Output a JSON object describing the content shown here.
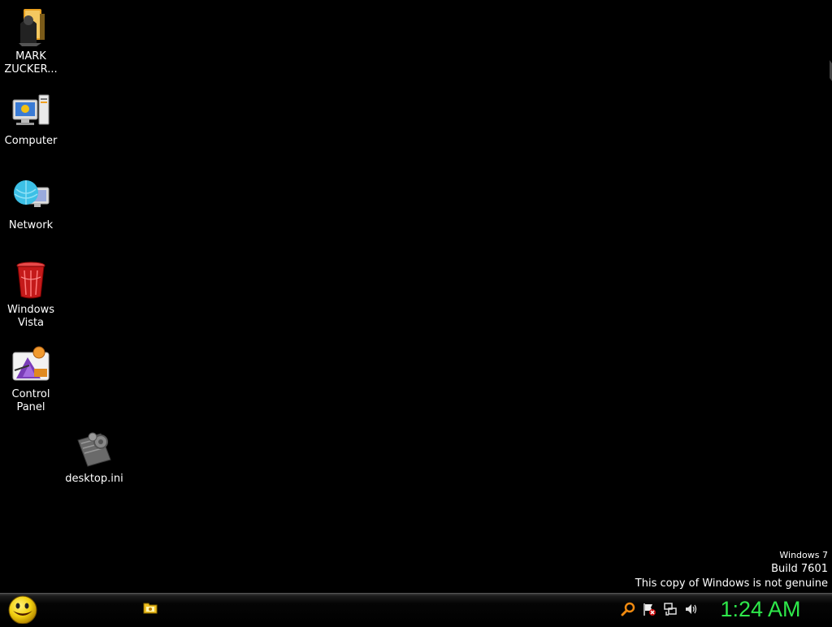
{
  "desktop": {
    "background_color": "#000000",
    "icons": [
      {
        "name": "MARK\nZUCKER...",
        "icon": "user-folder-icon"
      },
      {
        "name": "Computer",
        "icon": "computer-icon"
      },
      {
        "name": "Network",
        "icon": "network-icon"
      },
      {
        "name": "Windows\nVista",
        "icon": "recycle-bin-icon"
      },
      {
        "name": "Control\nPanel",
        "icon": "control-panel-icon"
      },
      {
        "name": "desktop.ini",
        "icon": "settings-file-icon"
      }
    ]
  },
  "watermark": {
    "os": "Windows 7",
    "build": "Build 7601",
    "genuine": "This copy of Windows is not genuine"
  },
  "taskbar": {
    "start_icon": "smiley-start-orb-icon",
    "pinned": [
      {
        "icon": "windows-explorer-icon"
      }
    ],
    "tray": [
      {
        "icon": "search-icon"
      },
      {
        "icon": "action-center-flag-icon"
      },
      {
        "icon": "network-tray-icon"
      },
      {
        "icon": "volume-icon"
      }
    ],
    "clock": "1:24 AM",
    "clock_color": "#2ee84a"
  }
}
